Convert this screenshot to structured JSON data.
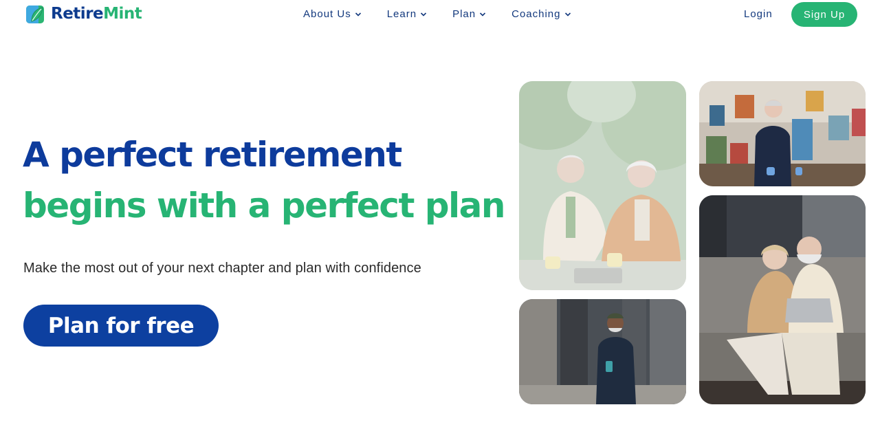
{
  "brand": {
    "name_part1": "Retire",
    "name_part2": "Mint",
    "colors": {
      "navy": "#0d3b9c",
      "mint": "#27b474",
      "sky": "#3fa9e0"
    }
  },
  "nav": {
    "items": [
      {
        "label": "About Us",
        "icon": "chevron-down-icon"
      },
      {
        "label": "Learn",
        "icon": "chevron-down-icon"
      },
      {
        "label": "Plan",
        "icon": "chevron-down-icon"
      },
      {
        "label": "Coaching",
        "icon": "chevron-down-icon"
      }
    ],
    "login_label": "Login",
    "signup_label": "Sign Up"
  },
  "hero": {
    "headline_line1": "A perfect retirement",
    "headline_line2": "begins with a perfect plan",
    "subtitle": "Make the most out of your next chapter and plan with confidence",
    "cta_label": "Plan for free"
  },
  "gallery": {
    "photos": [
      {
        "name": "photo-couple-coffee"
      },
      {
        "name": "photo-painter-studio"
      },
      {
        "name": "photo-man-walking"
      },
      {
        "name": "photo-couple-laptop"
      }
    ]
  }
}
